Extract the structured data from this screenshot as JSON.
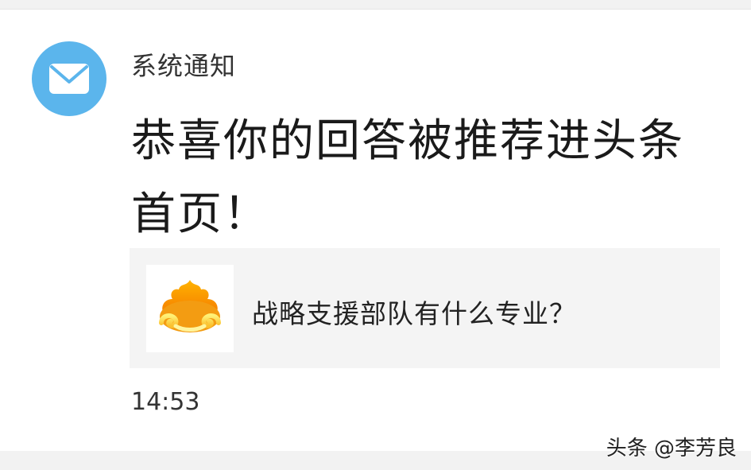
{
  "notification": {
    "sender": "系统通知",
    "avatar_icon": "mail-icon",
    "avatar_color": "#5bb5ec",
    "message": "恭喜你的回答被推荐进头条首页！",
    "card": {
      "thumbnail_icon": "wukong-cloud-logo-icon",
      "title": "战略支援部队有什么专业？"
    },
    "time": "14:53"
  },
  "watermark": "头条 @李芳良"
}
